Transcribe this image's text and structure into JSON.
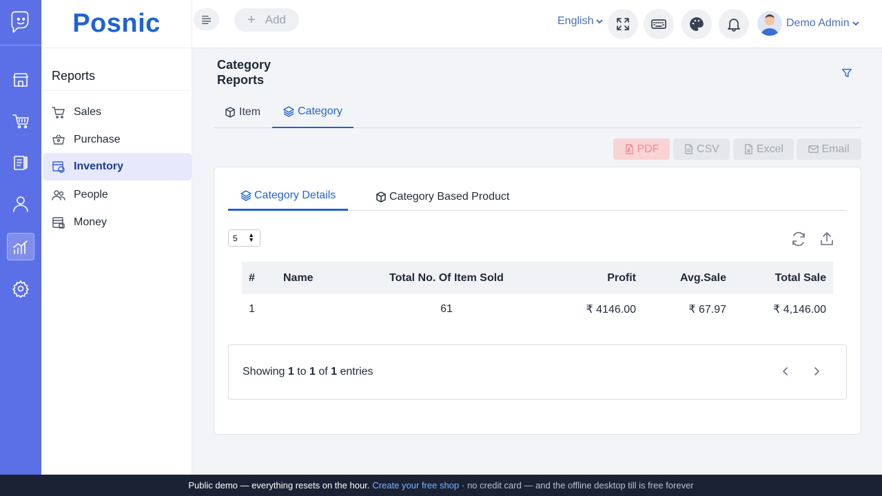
{
  "colors": {
    "rail": "#5b6fe6",
    "brand": "#1e63d6",
    "accent": "#1e63d6",
    "pdf_bg": "#f8d4d6",
    "footer_bg": "#1b2233"
  },
  "brand": {
    "name": "Posnic"
  },
  "rail": {
    "items": [
      {
        "icon": "store-icon"
      },
      {
        "icon": "cart-icon"
      },
      {
        "icon": "clipboard-icon"
      },
      {
        "icon": "user-icon"
      },
      {
        "icon": "chart-icon",
        "active": true
      },
      {
        "icon": "gear-icon"
      }
    ]
  },
  "sidebar": {
    "heading": "Reports",
    "items": [
      {
        "label": "Sales",
        "icon": "cart-icon"
      },
      {
        "label": "Purchase",
        "icon": "basket-icon"
      },
      {
        "label": "Inventory",
        "icon": "box-icon",
        "active": true
      },
      {
        "label": "People",
        "icon": "people-icon"
      },
      {
        "label": "Money",
        "icon": "wallet-icon"
      }
    ]
  },
  "topbar": {
    "add_label": "Add",
    "language": "English",
    "user_name": "Demo Admin"
  },
  "main": {
    "title_line1": "Category",
    "title_line2": "Reports",
    "tabs": [
      {
        "label": "Item"
      },
      {
        "label": "Category",
        "active": true
      }
    ],
    "exports": {
      "pdf": "PDF",
      "csv": "CSV",
      "excel": "Excel",
      "email": "Email"
    },
    "subtabs": [
      {
        "label": "Category Details",
        "active": true
      },
      {
        "label": "Category Based Product"
      }
    ],
    "page_size": "5",
    "table": {
      "headers": {
        "idx": "#",
        "name": "Name",
        "sold": "Total No. Of Item Sold",
        "profit": "Profit",
        "avg": "Avg.Sale",
        "total": "Total Sale"
      },
      "rows": [
        {
          "idx": "1",
          "name": "",
          "sold": "61",
          "profit": "₹ 4146.00",
          "avg": "₹ 67.97",
          "total": "₹ 4,146.00"
        }
      ]
    },
    "pager": {
      "showing": "Showing",
      "from": "1",
      "to_word": "to",
      "to": "1",
      "of_word": "of",
      "total": "1",
      "entries": "entries"
    }
  },
  "footer": {
    "text": "Public demo — everything resets on the hour.",
    "link": "Create your free shop",
    "rest": "· no credit card — and the offline desktop till is free forever"
  }
}
